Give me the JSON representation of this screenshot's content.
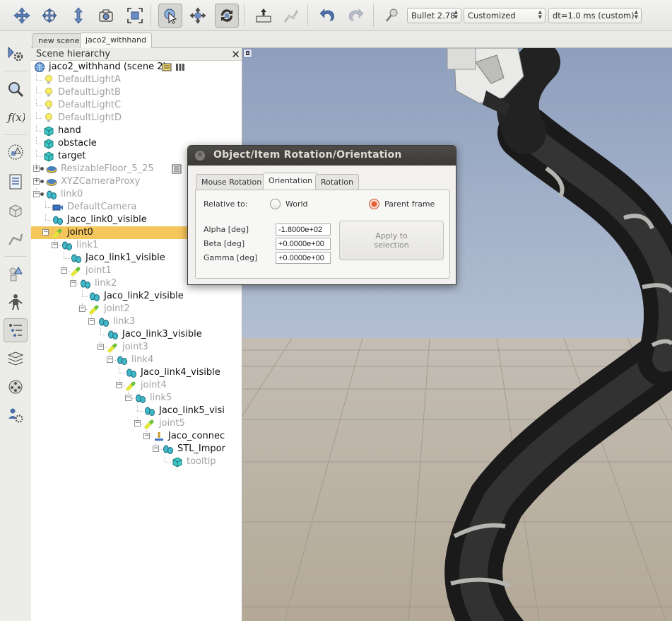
{
  "toolbar": {
    "engine": "Bullet 2.78",
    "preset": "Customized",
    "timestep": "dt=1.0 ms (custom)"
  },
  "scene_tabs": [
    "new scene",
    "jaco2_withhand"
  ],
  "hierarchy": {
    "title": "Scene hierarchy",
    "close": "✕",
    "items": [
      "jaco2_withhand (scene 2)",
      "DefaultLightA",
      "DefaultLightB",
      "DefaultLightC",
      "DefaultLightD",
      "hand",
      "obstacle",
      "target",
      "ResizableFloor_5_25",
      "XYZCameraProxy",
      "link0",
      "DefaultCamera",
      "Jaco_link0_visible",
      "joint0",
      "link1",
      "Jaco_link1_visible",
      "joint1",
      "link2",
      "Jaco_link2_visible",
      "joint2",
      "link3",
      "Jaco_link3_visible",
      "joint3",
      "link4",
      "Jaco_link4_visible",
      "joint4",
      "link5",
      "Jaco_link5_visi",
      "joint5",
      "Jaco_connec",
      "STL_Impor",
      "tooltip"
    ]
  },
  "dialog": {
    "title": "Object/Item Rotation/Orientation",
    "tabs": [
      "Mouse Rotation",
      "Orientation",
      "Rotation"
    ],
    "active_tab": "Orientation",
    "relative_to_label": "Relative to:",
    "option_world": "World",
    "option_parent": "Parent frame",
    "selected_option": "Parent frame",
    "alpha_label": "Alpha [deg]",
    "alpha_value": "-1.8000e+02",
    "beta_label": "Beta [deg]",
    "beta_value": "+0.0000e+00",
    "gamma_label": "Gamma [deg]",
    "gamma_value": "+0.0000e+00",
    "apply_line1": "Apply to",
    "apply_line2": "selection"
  },
  "colors": {
    "selection": "#f4c65c",
    "dialog_titlebar": "#3b3a36",
    "radio_accent": "#e8613a",
    "sky_top": "#8e9fbd",
    "floor": "#c9c0b2"
  }
}
